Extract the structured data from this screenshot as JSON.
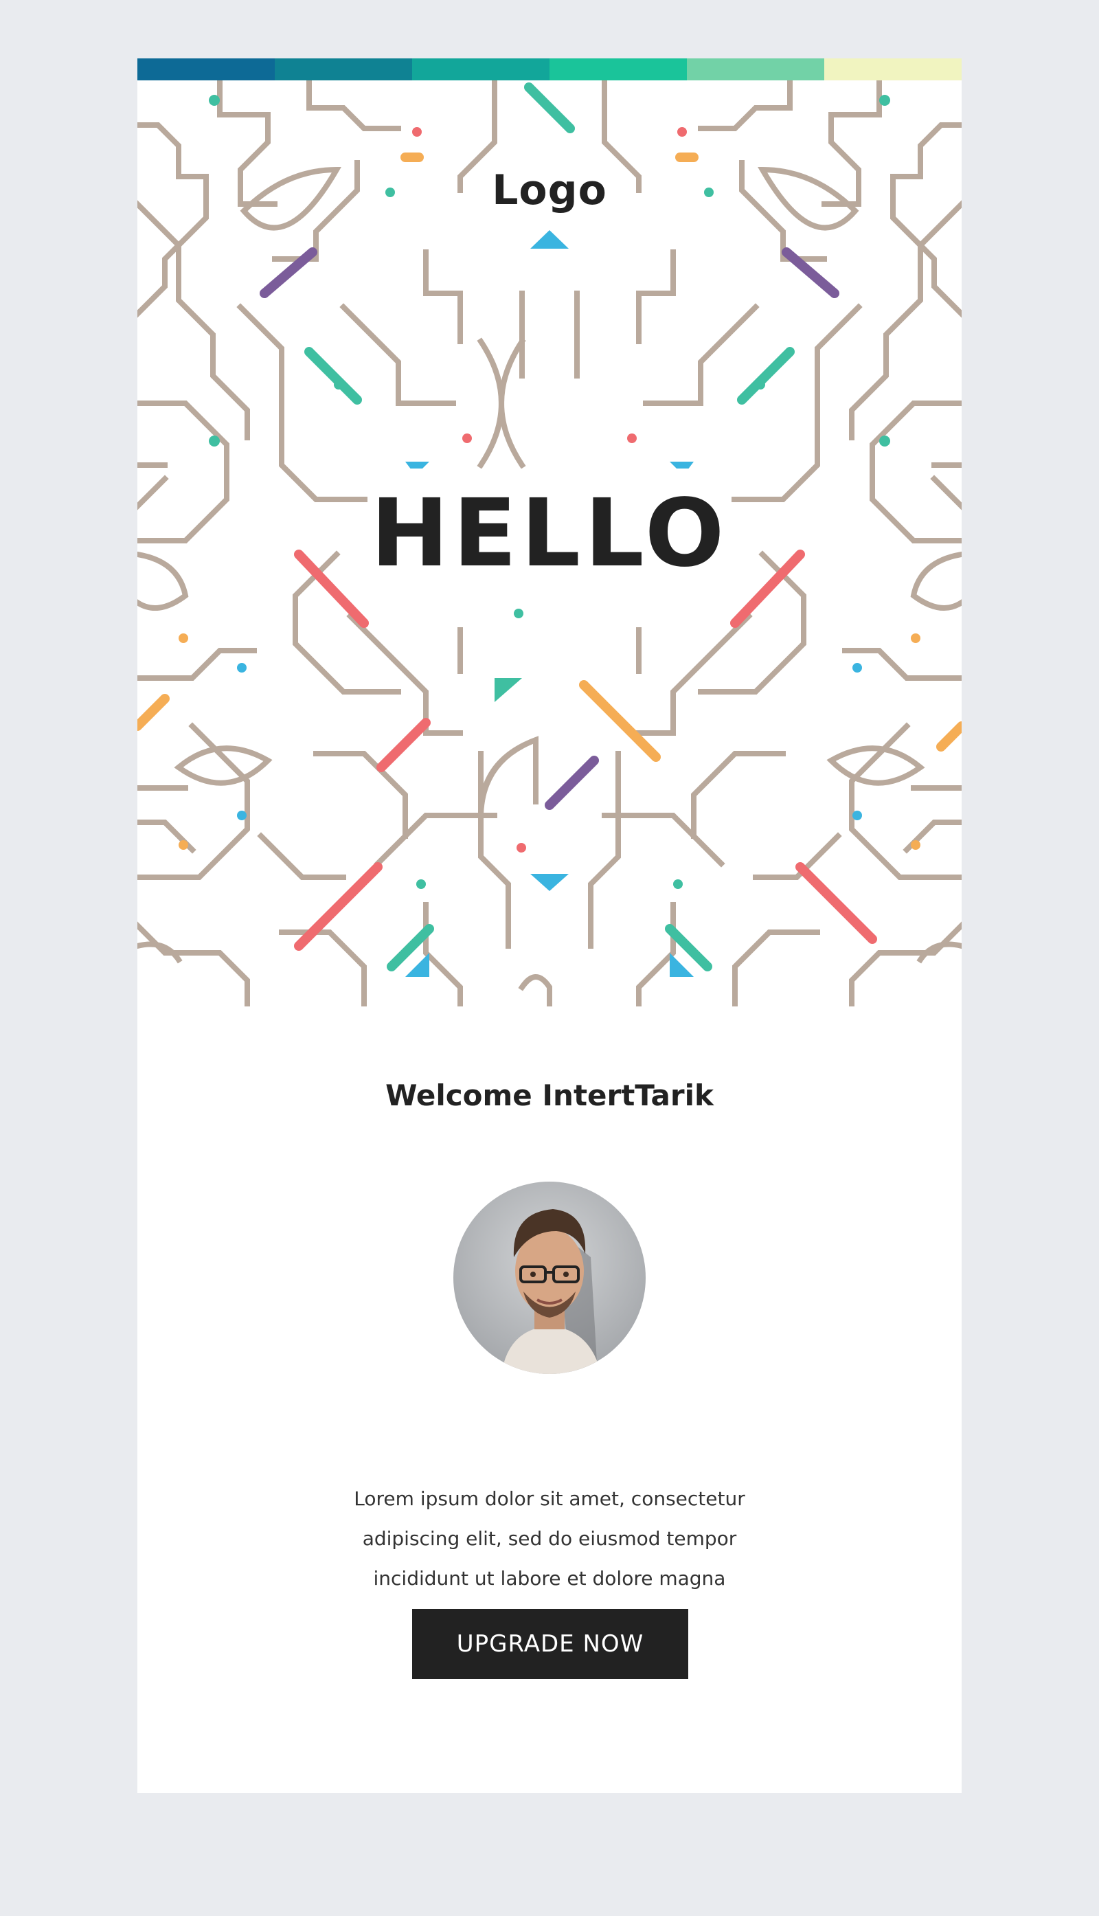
{
  "header": {
    "color_bar": [
      "#0d6a96",
      "#0f8293",
      "#12a69a",
      "#1ac49a",
      "#72d2a7",
      "#f1f4c0"
    ],
    "logo_text": "Logo"
  },
  "hero": {
    "headline": "HELLO",
    "pattern_colors": {
      "line": "#b9a99c",
      "red": "#ef6b6f",
      "teal": "#3fbfa1",
      "purple": "#7b5c9a",
      "orange": "#f5ad55",
      "blue": "#3ab4e0"
    }
  },
  "content": {
    "welcome": "Welcome IntertTarik",
    "avatar_icon": "person-portrait-icon",
    "paragraph_lines": [
      "Lorem ipsum dolor sit amet, consectetur",
      "adipiscing elit, sed do eiusmod tempor",
      "incididunt ut labore et dolore magna"
    ]
  },
  "cta": {
    "label": "UPGRADE NOW"
  }
}
